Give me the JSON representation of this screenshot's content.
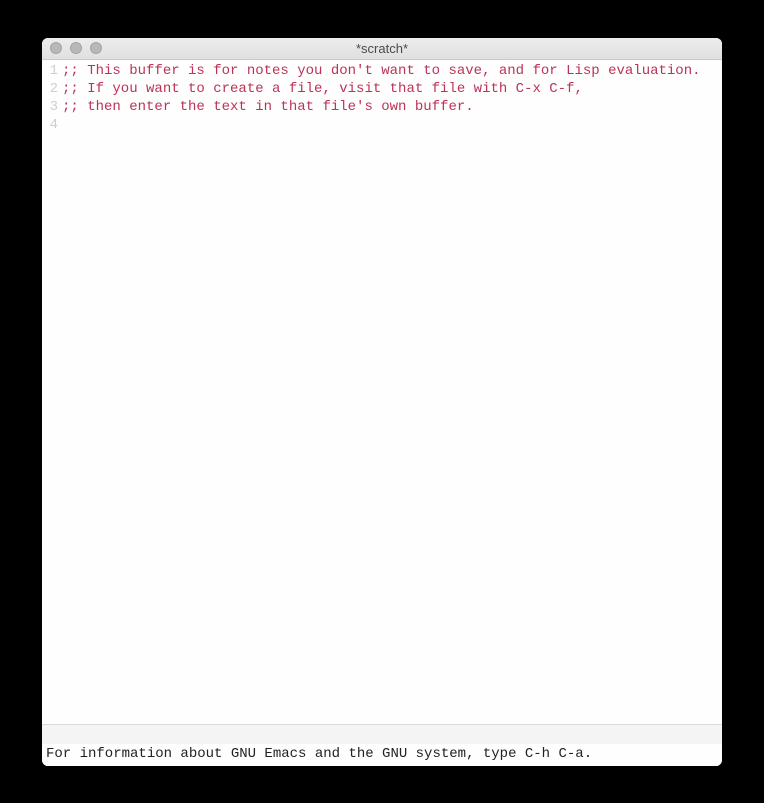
{
  "title": "*scratch*",
  "lines": [
    {
      "num": "1",
      "text": ";; This buffer is for notes you don't want to save, and for Lisp evaluation."
    },
    {
      "num": "2",
      "text": ";; If you want to create a file, visit that file with C-x C-f,"
    },
    {
      "num": "3",
      "text": ";; then enter the text in that file's own buffer."
    },
    {
      "num": "4",
      "text": ""
    }
  ],
  "minibuffer": "For information about GNU Emacs and the GNU system, type C-h C-a."
}
